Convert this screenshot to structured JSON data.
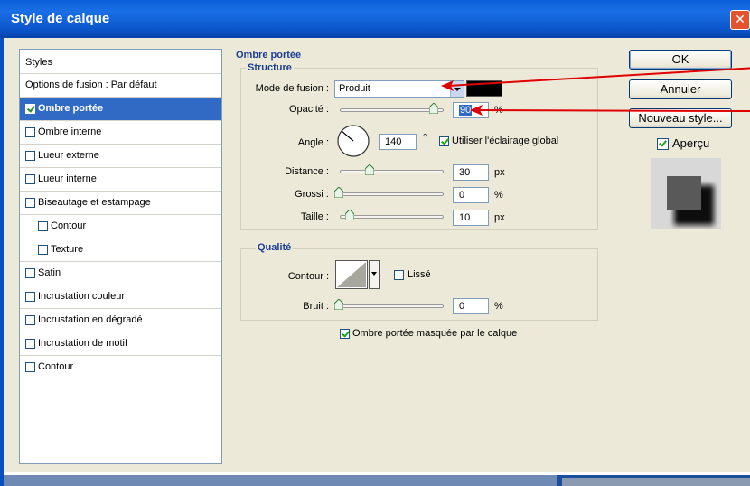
{
  "window": {
    "title": "Style de calque",
    "close_glyph": "✕"
  },
  "styles_panel": {
    "header": "Styles",
    "items": [
      {
        "label": "Options de fusion : Par défaut",
        "checkbox": false,
        "checked": false,
        "selected": false,
        "indent": 0
      },
      {
        "label": "Ombre portée",
        "checkbox": true,
        "checked": true,
        "selected": true,
        "indent": 0
      },
      {
        "label": "Ombre interne",
        "checkbox": true,
        "checked": false,
        "selected": false,
        "indent": 0
      },
      {
        "label": "Lueur externe",
        "checkbox": true,
        "checked": false,
        "selected": false,
        "indent": 0
      },
      {
        "label": "Lueur interne",
        "checkbox": true,
        "checked": false,
        "selected": false,
        "indent": 0
      },
      {
        "label": "Biseautage et estampage",
        "checkbox": true,
        "checked": false,
        "selected": false,
        "indent": 0
      },
      {
        "label": "Contour",
        "checkbox": true,
        "checked": false,
        "selected": false,
        "indent": 1
      },
      {
        "label": "Texture",
        "checkbox": true,
        "checked": false,
        "selected": false,
        "indent": 1
      },
      {
        "label": "Satin",
        "checkbox": true,
        "checked": false,
        "selected": false,
        "indent": 0
      },
      {
        "label": "Incrustation couleur",
        "checkbox": true,
        "checked": false,
        "selected": false,
        "indent": 0
      },
      {
        "label": "Incrustation en dégradé",
        "checkbox": true,
        "checked": false,
        "selected": false,
        "indent": 0
      },
      {
        "label": "Incrustation de motif",
        "checkbox": true,
        "checked": false,
        "selected": false,
        "indent": 0
      },
      {
        "label": "Contour",
        "checkbox": true,
        "checked": false,
        "selected": false,
        "indent": 0
      }
    ]
  },
  "drop_shadow": {
    "section_title": "Ombre portée",
    "structure": {
      "title": "Structure",
      "blend_mode_label": "Mode de fusion :",
      "blend_mode_value": "Produit",
      "shadow_color": "#000000",
      "opacity_label": "Opacité :",
      "opacity_value": "90",
      "opacity_unit": "%",
      "opacity_level": 0.9,
      "angle_label": "Angle :",
      "angle_value": "140",
      "angle_unit": "°",
      "global_light_label": "Utiliser l'éclairage global",
      "global_light_checked": true,
      "distance_label": "Distance :",
      "distance_value": "30",
      "distance_unit": "px",
      "spread_label": "Grossi :",
      "spread_value": "0",
      "spread_unit": "%",
      "size_label": "Taille :",
      "size_value": "10",
      "size_unit": "px"
    },
    "quality": {
      "title": "Qualité",
      "contour_label": "Contour :",
      "antialiased_label": "Lissé",
      "antialiased_checked": false,
      "noise_label": "Bruit :",
      "noise_value": "0",
      "noise_unit": "%"
    },
    "knockout_label": "Ombre portée masquée par le calque",
    "knockout_checked": true
  },
  "buttons": {
    "ok": "OK",
    "cancel": "Annuler",
    "new_style": "Nouveau style...",
    "preview_label": "Aperçu",
    "preview_checked": true
  },
  "colors": {
    "title_bar": "#0b54c8",
    "selection": "#316ac5",
    "group_title": "#1c3f94",
    "annotation_arrow": "#e00000"
  },
  "icons": {
    "close": "close-icon",
    "angle_dial": "angle-dial-icon",
    "contour_curve": "contour-curve-icon",
    "preview_swatch": "shadow-preview-icon"
  }
}
